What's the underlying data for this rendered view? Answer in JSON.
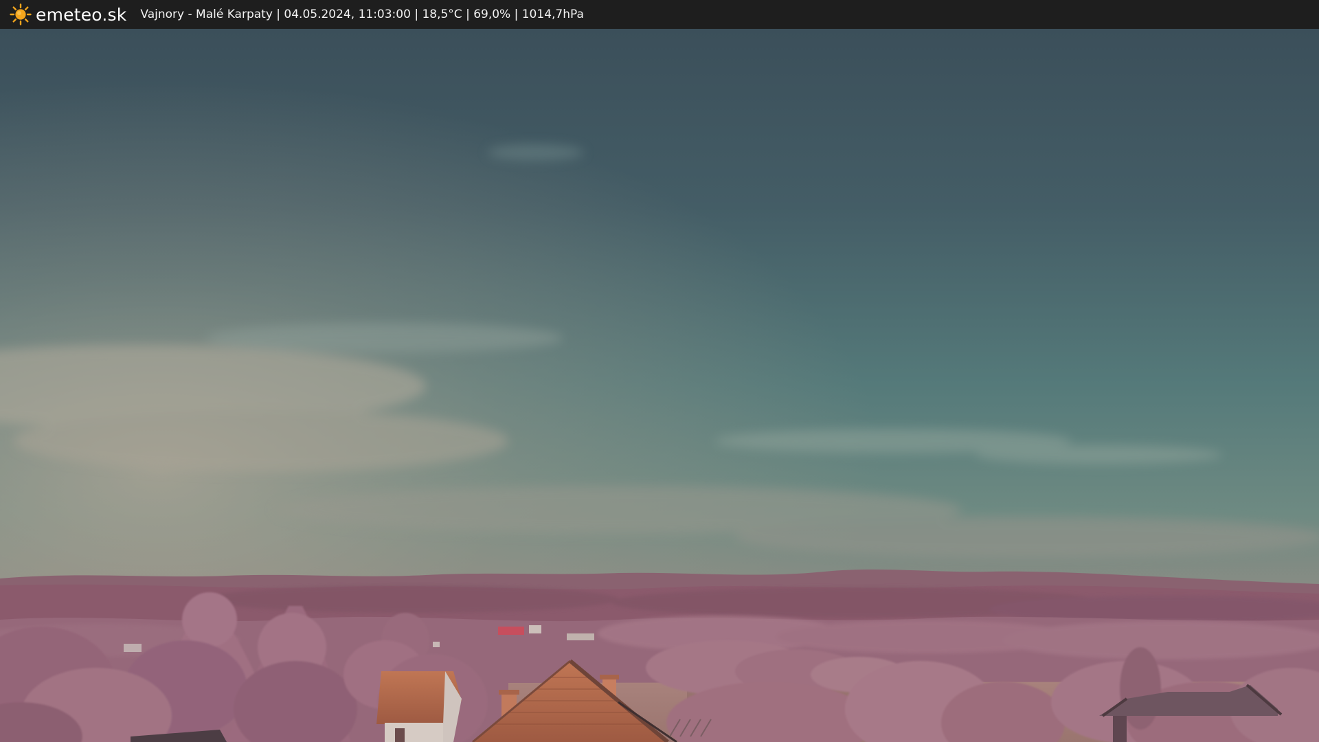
{
  "header": {
    "brand": "emeteo.sk",
    "brand_icon": "sun-icon",
    "caption": "Vajnory - Malé Karpaty | 04.05.2024, 11:03:00 | 18,5°C | 69,0% | 1014,7hPa"
  },
  "colors": {
    "bar": "#1e1e1e",
    "sun": "#f4a51c",
    "sky_top": "#3d535c",
    "sky_mid": "#587c7c",
    "horizon": "#8d8a82",
    "hills": "#8b5d6e",
    "foliage": "#9e6b7c",
    "roof": "#b86a4f"
  }
}
